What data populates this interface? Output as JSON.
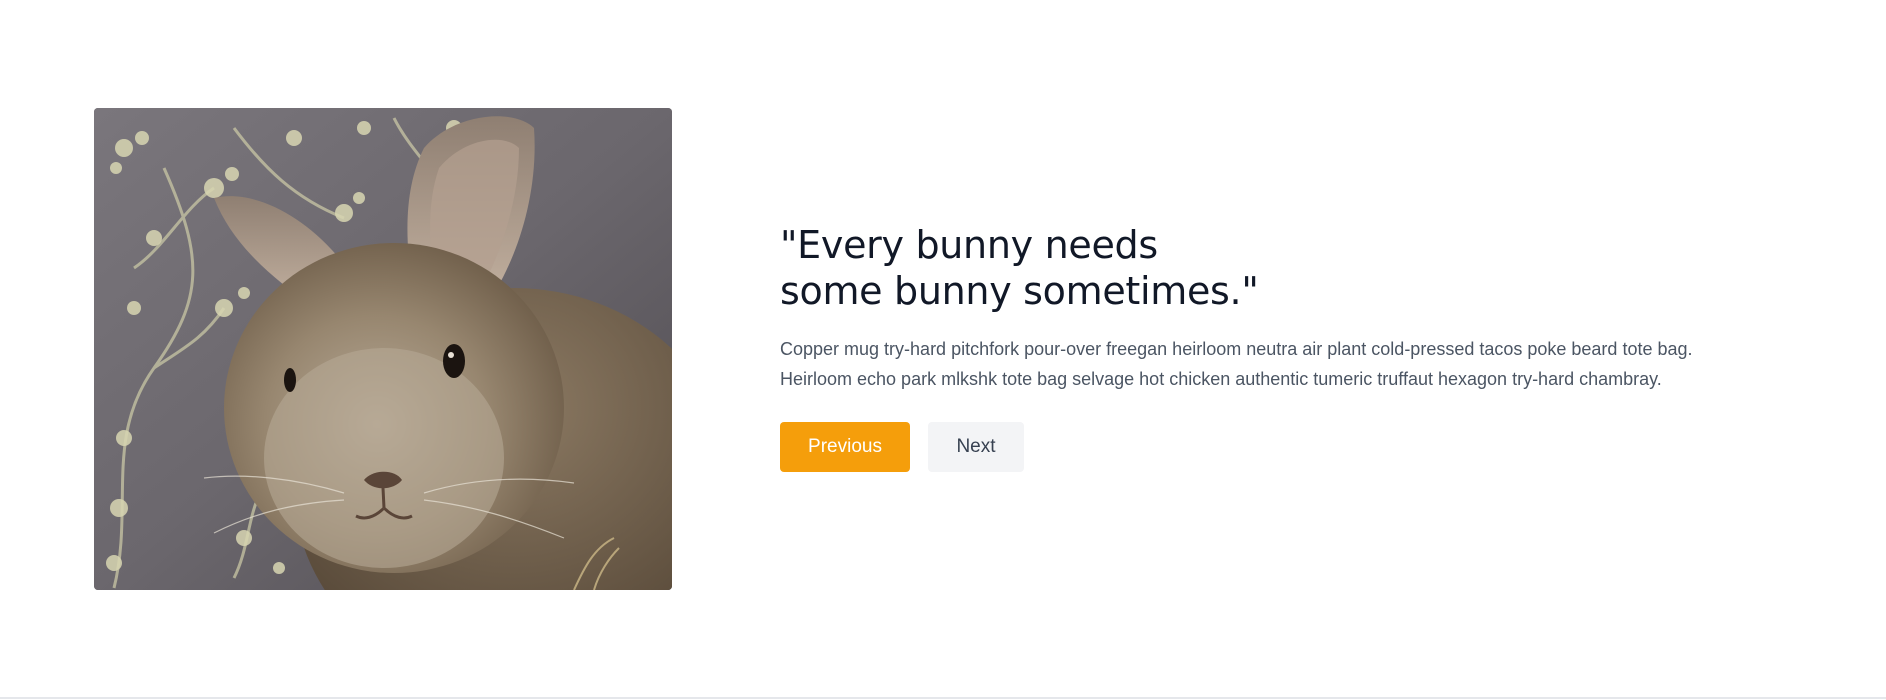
{
  "hero": {
    "image_alt": "Close-up photo of a fluffy brown bunny in front of a floral wallpaper",
    "headline_line1": "\"Every bunny needs",
    "headline_line2": "some bunny sometimes.\"",
    "body": "Copper mug try-hard pitchfork pour-over freegan heirloom neutra air plant cold-pressed tacos poke beard tote bag. Heirloom echo park mlkshk tote bag selvage hot chicken authentic tumeric truffaut hexagon try-hard chambray."
  },
  "buttons": {
    "previous_label": "Previous",
    "next_label": "Next"
  },
  "colors": {
    "accent": "#f59e0b",
    "secondary_bg": "#f3f4f6",
    "headline": "#111827",
    "body_text": "#4b5563"
  }
}
